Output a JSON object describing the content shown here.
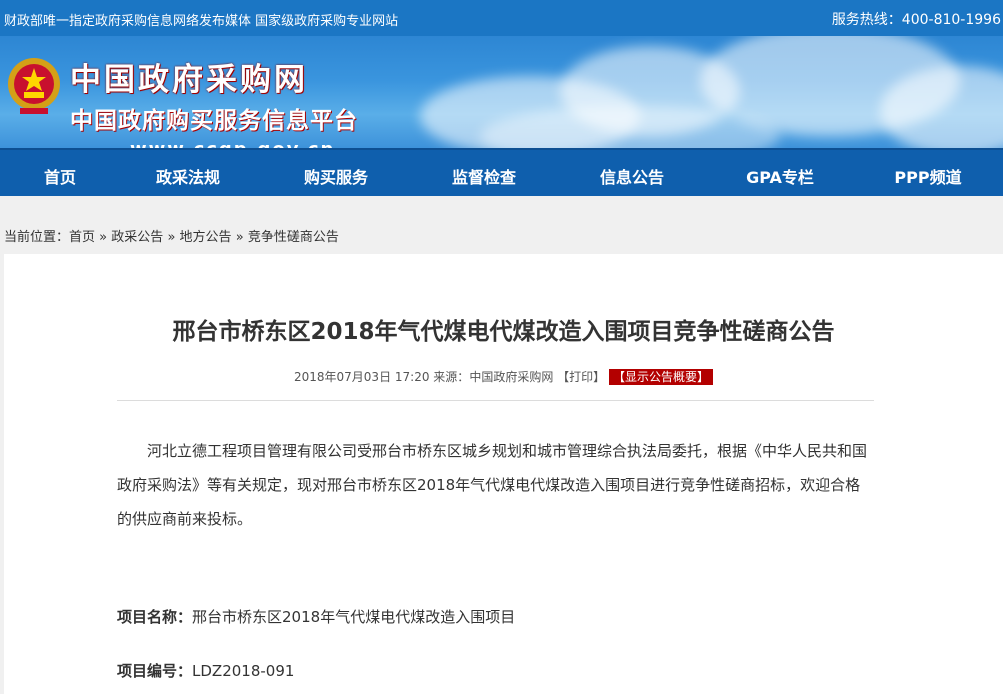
{
  "topbar": {
    "tagline": "财政部唯一指定政府采购信息网络发布媒体 国家级政府采购专业网站",
    "hotline": "服务热线：400-810-1996"
  },
  "header": {
    "site_name": "中国政府采购网",
    "subtitle": "中国政府购买服务信息平台",
    "url": "www.ccgp.gov.cn",
    "emblem_icon": "national-emblem-icon"
  },
  "nav": {
    "items": [
      {
        "label": "首页"
      },
      {
        "label": "政采法规"
      },
      {
        "label": "购买服务"
      },
      {
        "label": "监督检查"
      },
      {
        "label": "信息公告"
      },
      {
        "label": "GPA专栏"
      },
      {
        "label": "PPP频道"
      }
    ]
  },
  "breadcrumb": {
    "prefix": "当前位置：",
    "items": [
      "首页",
      "政采公告",
      "地方公告",
      "竞争性磋商公告"
    ],
    "separator": "»"
  },
  "article": {
    "title": "邢台市桥东区2018年气代煤电代煤改造入围项目竞争性磋商公告",
    "datetime": "2018年07月03日 17:20",
    "source_label": "来源：",
    "source": "中国政府采购网",
    "print_label": "【打印】",
    "summary_label": "【显示公告概要】",
    "intro": "河北立德工程项目管理有限公司受邢台市桥东区城乡规划和城市管理综合执法局委托，根据《中华人民共和国政府采购法》等有关规定，现对邢台市桥东区2018年气代煤电代煤改造入围项目进行竞争性磋商招标，欢迎合格的供应商前来投标。",
    "fields": [
      {
        "label": "项目名称：",
        "value": "邢台市桥东区2018年气代煤电代煤改造入围项目"
      },
      {
        "label": "项目编号：",
        "value": "LDZ2018-091"
      }
    ]
  },
  "colors": {
    "topbar": "#1b76c4",
    "nav": "#0f5fad",
    "badge": "#b30000"
  }
}
